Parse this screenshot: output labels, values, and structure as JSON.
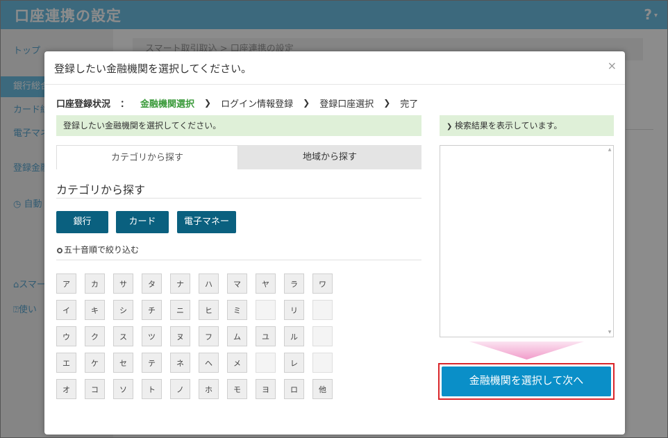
{
  "app": {
    "title": "口座連携の設定",
    "help_icon": "?"
  },
  "sidebar": {
    "items": [
      {
        "label": "トップ"
      },
      {
        "label": "銀行総合"
      },
      {
        "label": "カード総"
      },
      {
        "label": "電子マネ"
      },
      {
        "label": "登録金融"
      },
      {
        "label": "自動"
      },
      {
        "label": "スマー"
      },
      {
        "label": "使い"
      }
    ]
  },
  "breadcrumb": {
    "text": "スマート取引取込 > 口座連携の設定"
  },
  "modal": {
    "title": "登録したい金融機関を選択してください。",
    "close": "×",
    "steps": {
      "label": "口座登録状況",
      "colon": "：",
      "items": [
        "金融機関選択",
        "ログイン情報登録",
        "登録口座選択",
        "完了"
      ]
    },
    "info_left": "登録したい金融機関を選択してください。",
    "info_right": "検索結果を表示しています。",
    "tabs": [
      "カテゴリから探す",
      "地域から探す"
    ],
    "section_title": "カテゴリから探す",
    "categories": [
      "銀行",
      "カード",
      "電子マネー"
    ],
    "kana_title": "五十音順で絞り込む",
    "kana_columns": [
      [
        "ア",
        "イ",
        "ウ",
        "エ",
        "オ"
      ],
      [
        "カ",
        "キ",
        "ク",
        "ケ",
        "コ"
      ],
      [
        "サ",
        "シ",
        "ス",
        "セ",
        "ソ"
      ],
      [
        "タ",
        "チ",
        "ツ",
        "テ",
        "ト"
      ],
      [
        "ナ",
        "ニ",
        "ヌ",
        "ネ",
        "ノ"
      ],
      [
        "ハ",
        "ヒ",
        "フ",
        "ヘ",
        "ホ"
      ],
      [
        "マ",
        "ミ",
        "ム",
        "メ",
        "モ"
      ],
      [
        "ヤ",
        "",
        "ユ",
        "",
        "ヨ"
      ],
      [
        "ラ",
        "リ",
        "ル",
        "レ",
        "ロ"
      ],
      [
        "ワ",
        "",
        "",
        "",
        "他"
      ]
    ],
    "next_button": "金融機関を選択して次へ"
  },
  "colors": {
    "header": "#6ebfe4",
    "category_button": "#0a607f",
    "next_button": "#0a8fc8",
    "highlight_border": "#d9252a",
    "active_step": "#3a9a3a",
    "info_bg": "#dff0d8"
  }
}
